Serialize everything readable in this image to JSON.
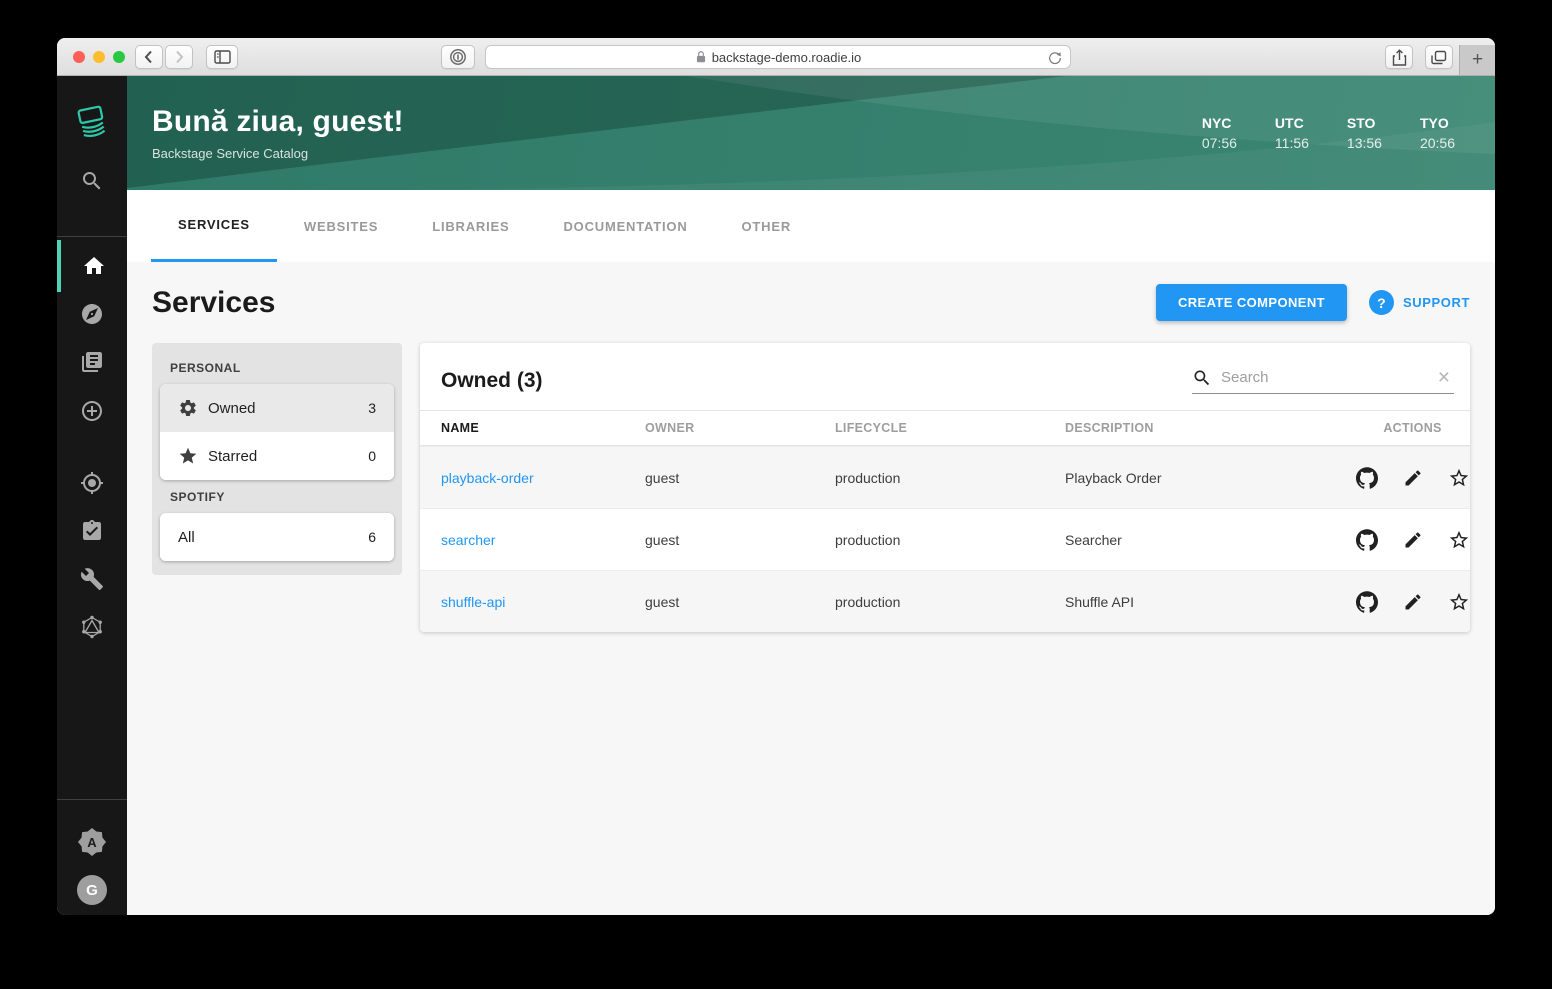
{
  "browser": {
    "url": "backstage-demo.roadie.io",
    "new_tab_label": "+"
  },
  "app_header": {
    "title": "Bună ziua, guest!",
    "subtitle": "Backstage Service Catalog",
    "clocks": [
      {
        "label": "NYC",
        "time": "07:56"
      },
      {
        "label": "UTC",
        "time": "11:56"
      },
      {
        "label": "STO",
        "time": "13:56"
      },
      {
        "label": "TYO",
        "time": "20:56"
      }
    ]
  },
  "tabs": {
    "items": [
      {
        "label": "SERVICES"
      },
      {
        "label": "WEBSITES"
      },
      {
        "label": "LIBRARIES"
      },
      {
        "label": "DOCUMENTATION"
      },
      {
        "label": "OTHER"
      }
    ]
  },
  "page": {
    "title": "Services",
    "create_button_label": "CREATE COMPONENT",
    "help_glyph": "?",
    "support_label": "SUPPORT"
  },
  "filters": {
    "personal_heading": "PERSONAL",
    "owned_label": "Owned",
    "owned_count": "3",
    "starred_label": "Starred",
    "starred_count": "0",
    "spotify_heading": "SPOTIFY",
    "all_label": "All",
    "all_count": "6"
  },
  "catalog": {
    "title": "Owned (3)",
    "search_placeholder": "Search",
    "columns": {
      "name": "NAME",
      "owner": "OWNER",
      "lifecycle": "LIFECYCLE",
      "description": "DESCRIPTION",
      "actions": "ACTIONS"
    },
    "rows": [
      {
        "name": "playback-order",
        "owner": "guest",
        "lifecycle": "production",
        "description": "Playback Order"
      },
      {
        "name": "searcher",
        "owner": "guest",
        "lifecycle": "production",
        "description": "Searcher"
      },
      {
        "name": "shuffle-api",
        "owner": "guest",
        "lifecycle": "production",
        "description": "Shuffle API"
      }
    ]
  },
  "nav": {
    "badge_letter": "A",
    "avatar_letter": "G"
  },
  "colors": {
    "accent_blue": "#2196f3",
    "header_green": "#35806d",
    "logo_teal": "#2dc8a8",
    "sidebar_dark": "#171717",
    "traffic_red": "#ff5f57",
    "traffic_yellow": "#febc2e",
    "traffic_green": "#28c840"
  }
}
